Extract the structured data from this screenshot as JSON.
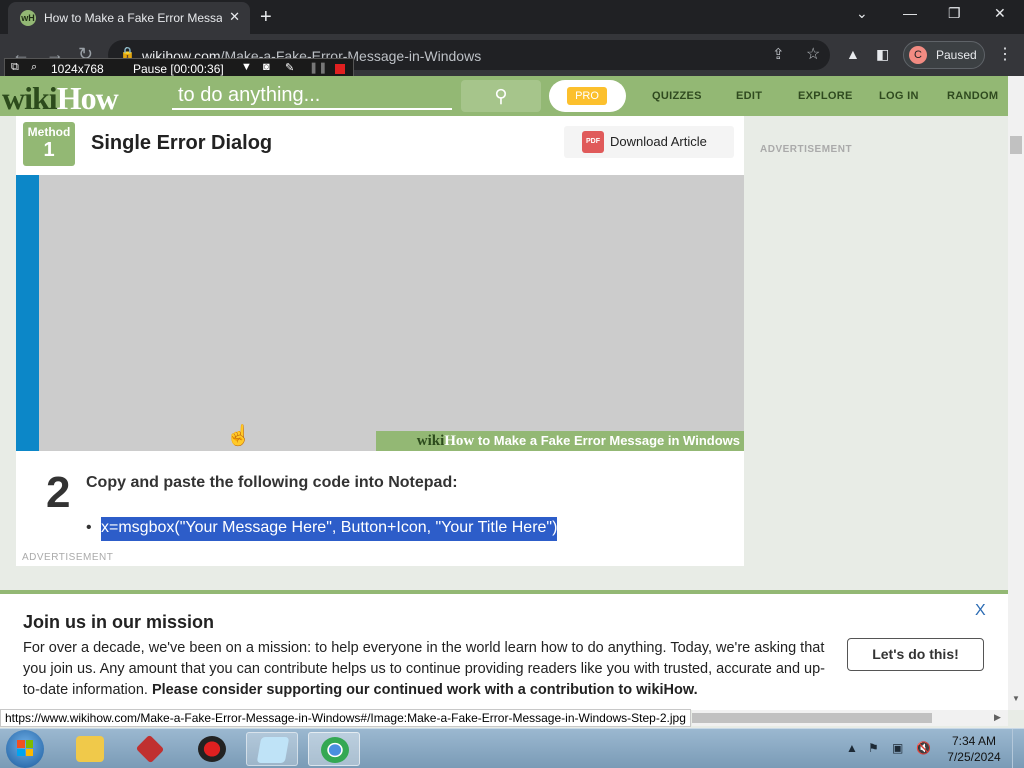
{
  "browser": {
    "tab_title": "How to Make a Fake Error Message in Windows",
    "favicon_text": "wH",
    "url_host": "wikihow.com",
    "url_path": "/Make-a-Fake-Error-Message-in-Windows",
    "profile_initial": "C",
    "profile_status": "Paused"
  },
  "recorder": {
    "size": "1024x768",
    "status": "Pause [00:00:36]"
  },
  "site": {
    "logo_wiki": "wiki",
    "logo_how": "How",
    "search_placeholder": "to do anything...",
    "pro_label": "PRO",
    "nav": [
      "QUIZZES",
      "EDIT",
      "EXPLORE",
      "LOG IN",
      "RANDOM"
    ]
  },
  "article": {
    "method_label": "Method",
    "method_number": "1",
    "method_title": "Single Error Dialog",
    "download_label": "Download Article",
    "pdf_label": "PDF",
    "image_watermark_wiki": "wiki",
    "image_watermark_how": "How",
    "image_watermark_text": " to Make a Fake Error Message in Windows",
    "step_number": "2",
    "step_text": "Copy and paste the following code into Notepad:",
    "code_line": "x=msgbox(\"Your Message Here\", Button+Icon, \"Your Title Here\")",
    "ad_label": "ADVERTISEMENT",
    "sidebar_ad_label": "ADVERTISEMENT"
  },
  "mission": {
    "title": "Join us in our mission",
    "body": "For over a decade, we've been on a mission: to help everyone in the world learn how to do anything. Today, we're asking that you join us. Any amount that you can contribute helps us to continue providing readers like you with trusted, accurate and up-to-date information. ",
    "body_bold": "Please consider supporting our continued work with a contribution to wikiHow.",
    "close": "X",
    "cta": "Let's do this!"
  },
  "status_url": "https://www.wikihow.com/Make-a-Fake-Error-Message-in-Windows#/Image:Make-a-Fake-Error-Message-in-Windows-Step-2.jpg",
  "taskbar": {
    "time": "7:34 AM",
    "date": "7/25/2024",
    "items": [
      "windows-explorer",
      "winrar",
      "media-player",
      "notepad",
      "chrome"
    ]
  },
  "colors": {
    "brand_green": "#93b874",
    "selection_blue": "#2d5dc9",
    "pro_yellow": "#fcc02d"
  }
}
